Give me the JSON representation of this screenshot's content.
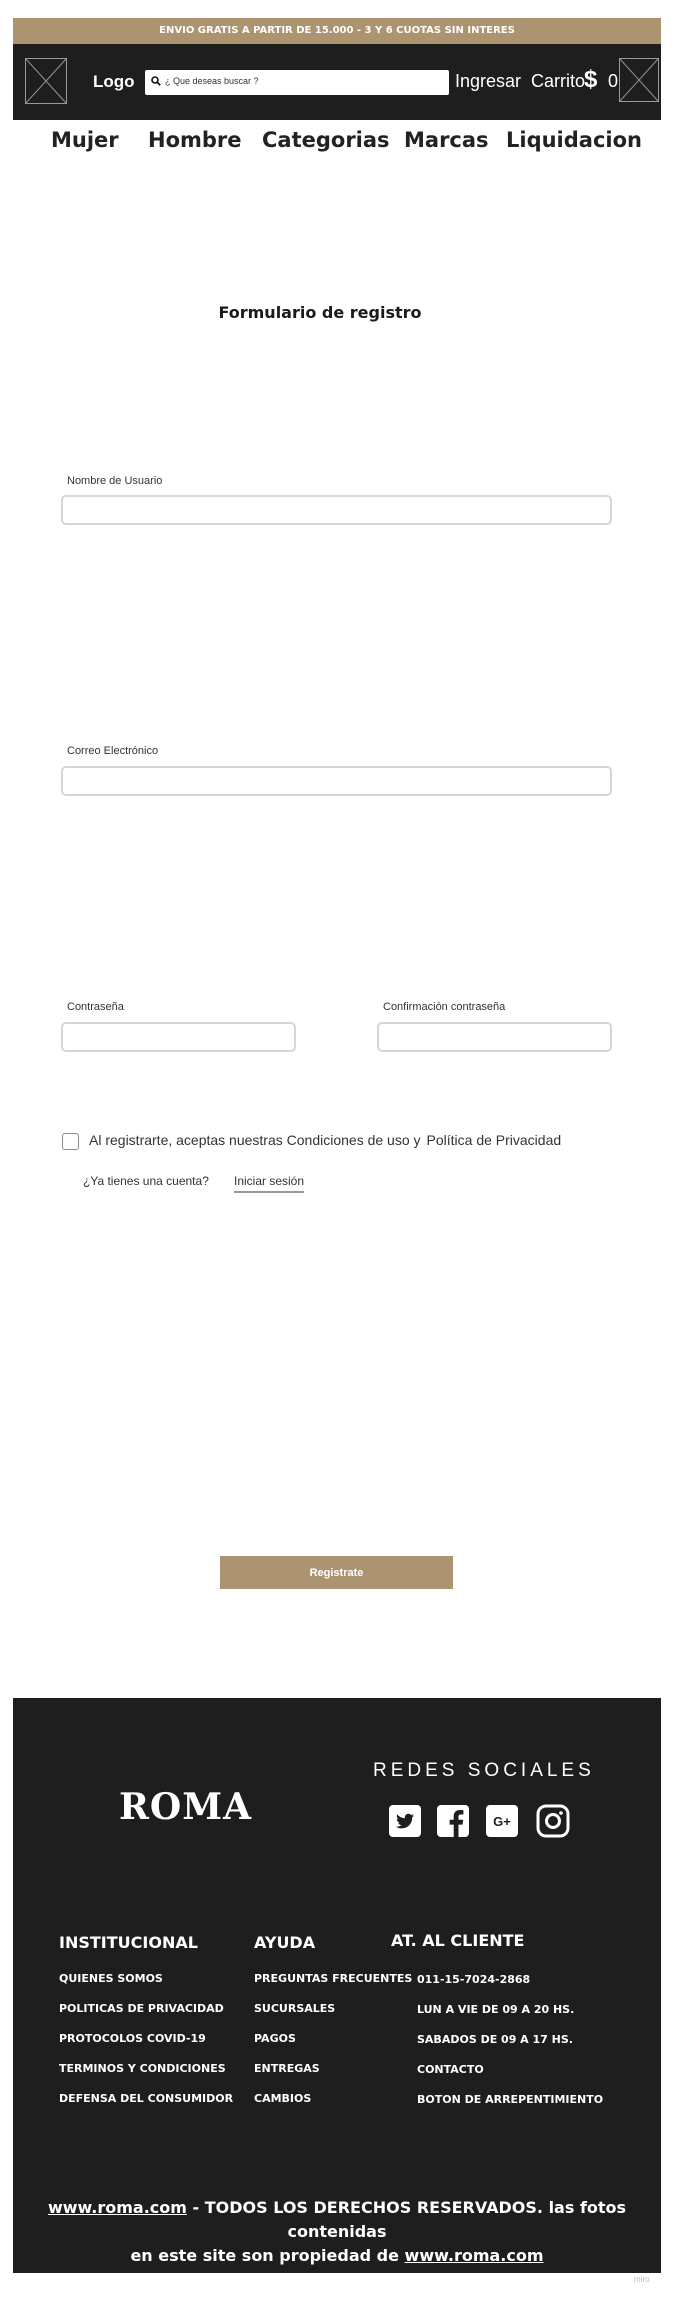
{
  "announcement": "ENVIO GRATIS A PARTIR DE 15.000 - 3 Y 6 CUOTAS SIN INTERES",
  "header": {
    "logo": "Logo",
    "search_placeholder": "¿ Que deseas buscar ?",
    "login": "Ingresar",
    "cart_label": "Carrito",
    "cart_symbol": "$",
    "cart_count": "0"
  },
  "nav": [
    "Mujer",
    "Hombre",
    "Categorias",
    "Marcas",
    "Liquidacion"
  ],
  "form": {
    "title": "Formulario de registro",
    "username_label": "Nombre de Usuario",
    "email_label": "Correo Electrónico",
    "password_label": "Contraseña",
    "confirm_label": "Confirmación contraseña",
    "terms_prefix": "Al registrarte, aceptas nuestras Condiciones de uso y",
    "terms_link": "Política de Privacidad",
    "have_account": "¿Ya tienes una cuenta?",
    "signin_link": "Iniciar sesión",
    "submit": "Registrate"
  },
  "footer": {
    "brand": "ROMA",
    "social_title": "REDES SOCIALES",
    "social_icons": [
      "twitter-icon",
      "facebook-icon",
      "google-plus-icon",
      "instagram-icon"
    ],
    "columns": [
      {
        "title": "INSTITUCIONAL",
        "items": [
          "QUIENES SOMOS",
          "POLITICAS DE PRIVACIDAD",
          "PROTOCOLOS COVID-19",
          "TERMINOS Y CONDICIONES",
          "DEFENSA DEL CONSUMIDOR"
        ]
      },
      {
        "title": "AYUDA",
        "items": [
          "PREGUNTAS FRECUENTES",
          "SUCURSALES",
          "PAGOS",
          "ENTREGAS",
          "CAMBIOS"
        ]
      },
      {
        "title": "AT. AL CLIENTE",
        "items": [
          "011-15-7024-2868",
          "LUN A VIE DE 09 A 20 HS.",
          "SABADOS DE 09 A 17 HS.",
          "CONTACTO",
          "BOTON DE ARREPENTIMIENTO"
        ]
      }
    ],
    "copyright_link": "www.roma.com",
    "copyright_text_1": "- TODOS LOS DERECHOS RESERVADOS. las fotos contenidas",
    "copyright_text_2": "en este site son propiedad de",
    "copyright_link_2": "www.roma.com"
  },
  "watermark": "miro",
  "colors": {
    "accent": "#ad9470",
    "dark": "#1e1e1e"
  }
}
